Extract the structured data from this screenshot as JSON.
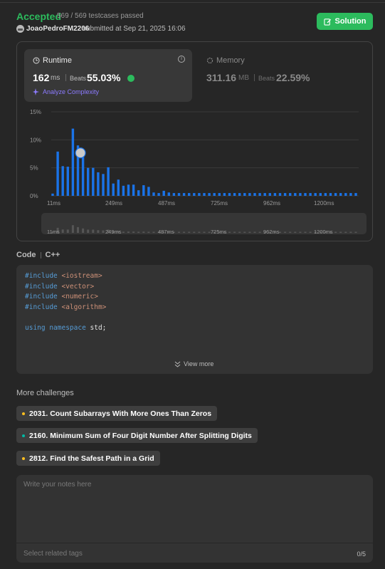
{
  "header": {
    "status": "Accepted",
    "testcases": "569 / 569 testcases passed",
    "submitter": "JoaoPedroFM2206",
    "submitted_at": "submitted at Sep 21, 2025 16:06",
    "solution_button": "Solution"
  },
  "runtime": {
    "title": "Runtime",
    "value": "162",
    "unit": "ms",
    "beats_label": "Beats",
    "beats_value": "55.03%",
    "analyze_label": "Analyze Complexity"
  },
  "memory": {
    "title": "Memory",
    "value": "311.16",
    "unit": "MB",
    "beats_label": "Beats",
    "beats_value": "22.59%"
  },
  "chart_data": {
    "type": "bar",
    "y_ticks": [
      "15%",
      "10%",
      "5%",
      "0%"
    ],
    "x_ticks": [
      "11ms",
      "249ms",
      "487ms",
      "725ms",
      "962ms",
      "1200ms"
    ],
    "ylim": [
      0,
      15
    ],
    "values": [
      0.4,
      7.9,
      5.3,
      5.2,
      12.0,
      9.0,
      6.9,
      5.0,
      5.0,
      4.2,
      3.9,
      5.1,
      2.2,
      2.9,
      1.8,
      2.0,
      2.0,
      1.0,
      1.9,
      1.6,
      0.6,
      0.5,
      0.9,
      0.6,
      0.5,
      0.5,
      0.5,
      0.5,
      0.5,
      0.5,
      0.5,
      0.5,
      0.5,
      0.5,
      0.5,
      0.5,
      0.5,
      0.5,
      0.5,
      0.5,
      0.5,
      0.5,
      0.5,
      0.5,
      0.5,
      0.5,
      0.5,
      0.5,
      0.5,
      0.5,
      0.5,
      0.5,
      0.5,
      0.5,
      0.5,
      0.5,
      0.5,
      0.5,
      0.5,
      0.5,
      0.5
    ],
    "user_bar_index": 6,
    "bar_color": "#1a73e8"
  },
  "code": {
    "header": "Code",
    "language": "C++",
    "lines": [
      {
        "kw": "#include",
        "rest": " <iostream>"
      },
      {
        "kw": "#include",
        "rest": " <vector>"
      },
      {
        "kw": "#include",
        "rest": " <numeric>"
      },
      {
        "kw": "#include",
        "rest": " <algorithm>"
      },
      {
        "kw": "",
        "rest": ""
      },
      {
        "kw": "using namespace",
        "rest": " std;"
      }
    ],
    "view_more": "View more"
  },
  "challenges": {
    "header": "More challenges",
    "items": [
      {
        "label": "2031. Count Subarrays With More Ones Than Zeros",
        "color": "#ffc01e"
      },
      {
        "label": "2160. Minimum Sum of Four Digit Number After Splitting Digits",
        "color": "#00b8a3"
      },
      {
        "label": "2812. Find the Safest Path in a Grid",
        "color": "#ffc01e"
      }
    ]
  },
  "notes": {
    "placeholder": "Write your notes here",
    "tags_placeholder": "Select related tags",
    "tags_count": "0/5"
  }
}
